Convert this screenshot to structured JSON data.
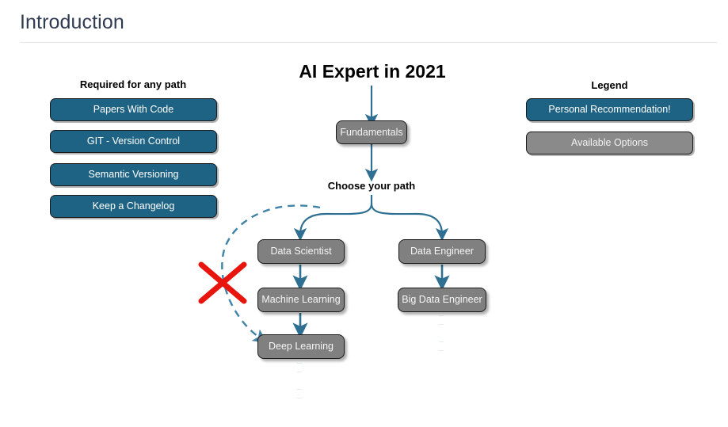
{
  "header": {
    "title": "Introduction"
  },
  "chart_data": {
    "type": "diagram",
    "title": "AI Expert in 2021",
    "subtitle": "Choose your path",
    "colors": {
      "recommended": "#1f6384",
      "optional": "#808080",
      "connector": "#2e6f92",
      "blocked_mark": "#e8150f",
      "title_text": "#2f3b52"
    },
    "nodes": [
      {
        "id": "fundamentals",
        "label": "Fundamentals",
        "style": "optional"
      },
      {
        "id": "data-scientist",
        "label": "Data Scientist",
        "style": "optional"
      },
      {
        "id": "machine-learning",
        "label": "Machine Learning",
        "style": "optional"
      },
      {
        "id": "deep-learning",
        "label": "Deep Learning",
        "style": "optional"
      },
      {
        "id": "data-engineer",
        "label": "Data Engineer",
        "style": "optional"
      },
      {
        "id": "big-data-engineer",
        "label": "Big Data Engineer",
        "style": "optional"
      }
    ],
    "edges": [
      {
        "from": "title",
        "to": "fundamentals",
        "style": "solid-arrow"
      },
      {
        "from": "fundamentals",
        "to": "choose-your-path",
        "style": "solid-arrow"
      },
      {
        "from": "choose-your-path",
        "to": "data-scientist",
        "style": "solid-curve-arrow"
      },
      {
        "from": "choose-your-path",
        "to": "data-engineer",
        "style": "solid-curve-arrow"
      },
      {
        "from": "data-scientist",
        "to": "machine-learning",
        "style": "solid-arrow"
      },
      {
        "from": "machine-learning",
        "to": "deep-learning",
        "style": "solid-arrow"
      },
      {
        "from": "data-engineer",
        "to": "big-data-engineer",
        "style": "solid-arrow"
      },
      {
        "from": "choose-your-path",
        "to": "deep-learning",
        "style": "dashed-curve-arrow",
        "blocked": true
      },
      {
        "from": "deep-learning",
        "to": "continues",
        "style": "dotted"
      },
      {
        "from": "big-data-engineer",
        "to": "continues",
        "style": "dotted"
      }
    ]
  },
  "required_section": {
    "heading": "Required for any path",
    "items": [
      {
        "label": "Papers With Code"
      },
      {
        "label": "GIT - Version Control"
      },
      {
        "label": "Semantic Versioning"
      },
      {
        "label": "Keep a Changelog"
      }
    ]
  },
  "legend_section": {
    "heading": "Legend",
    "items": [
      {
        "label": "Personal Recommendation!",
        "style": "teal"
      },
      {
        "label": "Available Options",
        "style": "gray"
      }
    ]
  }
}
